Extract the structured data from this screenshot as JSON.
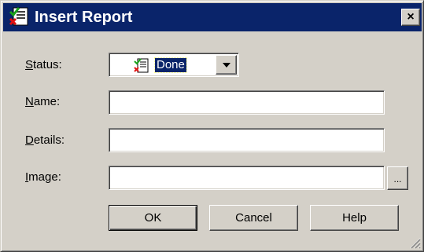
{
  "window": {
    "title": "Insert Report",
    "icon": "report-icon",
    "close_label": "×"
  },
  "form": {
    "status": {
      "label_accel": "S",
      "label_rest": "tatus:",
      "value": "Done",
      "icon": "report-done-icon"
    },
    "name": {
      "label_accel": "N",
      "label_rest": "ame:",
      "value": ""
    },
    "details": {
      "label_accel": "D",
      "label_rest": "etails:",
      "value": ""
    },
    "image": {
      "label_accel": "I",
      "label_rest": "mage:",
      "value": "",
      "browse_label": "..."
    }
  },
  "buttons": {
    "ok": "OK",
    "cancel": "Cancel",
    "help": "Help"
  },
  "colors": {
    "titlebar": "#0a246a",
    "face": "#d4d0c8",
    "selection": "#0a246a"
  }
}
